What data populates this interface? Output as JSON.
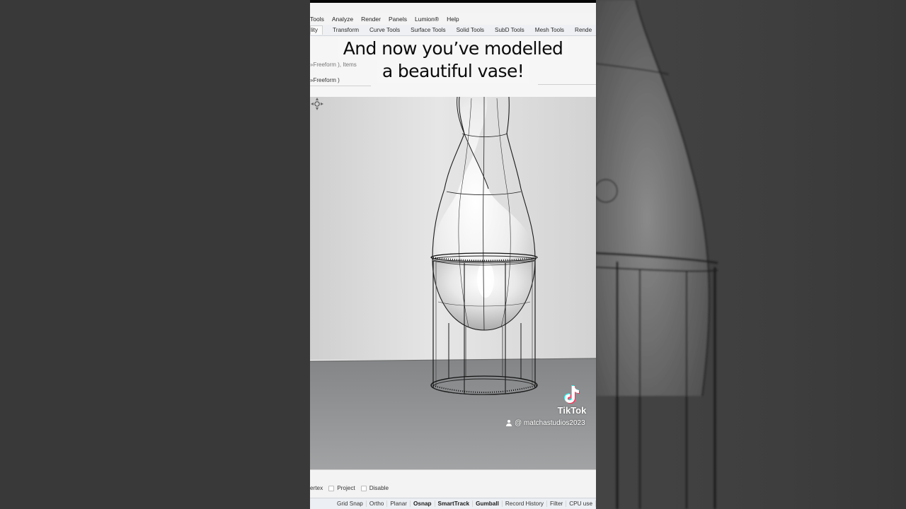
{
  "app": {
    "menu_items": [
      "Tools",
      "Analyze",
      "Render",
      "Panels",
      "Lumion®",
      "Help"
    ],
    "tabs": [
      "lity",
      "Transform",
      "Curve Tools",
      "Surface Tools",
      "Solid Tools",
      "SubD Tools",
      "Mesh Tools",
      "Rende"
    ],
    "active_tab_index": 0,
    "command_line_1": "»Freeform ), Items",
    "command_line_2": "»Freeform )"
  },
  "caption": {
    "line1": "And now you’ve modelled",
    "line2": "a beautiful vase!"
  },
  "watermark": {
    "brand": "TikTok",
    "handle": "@ matchastudios2023"
  },
  "osnap_panel": {
    "partial_label": "ertex",
    "options": [
      "Project",
      "Disable"
    ]
  },
  "status_bar": {
    "items": [
      {
        "label": "Grid Snap",
        "bold": false
      },
      {
        "label": "Ortho",
        "bold": false
      },
      {
        "label": "Planar",
        "bold": false
      },
      {
        "label": "Osnap",
        "bold": true
      },
      {
        "label": "SmartTrack",
        "bold": true
      },
      {
        "label": "Gumball",
        "bold": true
      },
      {
        "label": "Record History",
        "bold": false
      },
      {
        "label": "Filter",
        "bold": false
      },
      {
        "label": "CPU use",
        "bold": false
      }
    ]
  },
  "colors": {
    "background": "#3a3a3a",
    "viewport_wall": "#dcdcdc",
    "viewport_floor": "#8f9193",
    "vase_surface": "#f2f2f2",
    "wireframe": "#1a1a1a"
  },
  "icons": [
    "tiktok-logo-icon",
    "user-icon",
    "gumball-icon"
  ]
}
